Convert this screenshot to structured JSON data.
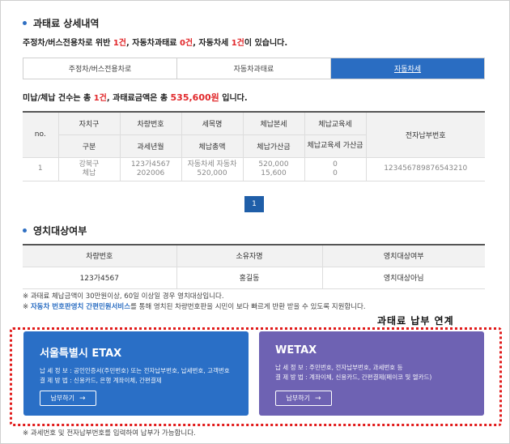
{
  "section1": {
    "title": "과태료 상세내역"
  },
  "summary": {
    "prefix": "주정차/버스전용차로 위반",
    "parking_count": "1건",
    "mid1": ", 자동차과태료",
    "car_count": "0건",
    "mid2": ", 자동차세",
    "tax_count": "1건",
    "suffix": "이 있습니다."
  },
  "tabs": [
    {
      "label": "주정차/버스전용차로"
    },
    {
      "label": "자동차과태료"
    },
    {
      "label": "자동차세"
    }
  ],
  "overdue": {
    "prefix": "미납/체납 건수는 총",
    "count": "1건",
    "mid": ", 과태료금액은 총",
    "amount": "535,600원",
    "suffix": "입니다."
  },
  "detail_table": {
    "headers_row1": [
      "no.",
      "자치구",
      "차량번호",
      "세목명",
      "체납본세",
      "체납교육세",
      "전자납부번호"
    ],
    "headers_row2": [
      "구분",
      "과세년월",
      "체납총액",
      "체납가산금",
      "체납교육세 가산금"
    ],
    "row": {
      "no": "1",
      "district": "강북구",
      "category": "체납",
      "plate": "123가4567",
      "tax_month": "202006",
      "tax_name": "자동차세 자동차",
      "total": "520,000",
      "principal": "520,000",
      "penalty": "15,600",
      "edu": "0",
      "edu_penalty": "0",
      "payment_no": "123456789876543210"
    }
  },
  "pagination": {
    "current": "1"
  },
  "section2": {
    "title": "영치대상여부"
  },
  "seizure_table": {
    "headers": [
      "차량번호",
      "소유자명",
      "영치대상여부"
    ],
    "row": {
      "plate": "123가4567",
      "owner": "홍길동",
      "status": "영치대상아님"
    }
  },
  "notes": {
    "line1": "※ 과태료 체납금액이 30만원이상, 60일 이상일 경우 영치대상입니다.",
    "line2_prefix": "※",
    "line2_link": "자동차 번호판영치 간편민원서비스",
    "line2_suffix": "를 통해 영치된 차량번호판을 시민이 보다 빠르게 반환 받을 수 있도록 지원합니다.",
    "bottom": "※ 과세번호 및 전자납부번호를 입력하여 납부가 가능합니다."
  },
  "link_label": "과태료 납부 연계",
  "cards": {
    "etax": {
      "title": "서울특별시 ETAX",
      "info": "납 세 정 보 : 공인인증서(주민번호) 또는 전자납부번호, 납세번호, 고객번호",
      "method": "결 제 방 법 : 신용카드, 은행 계좌이체, 간편결제",
      "button": "납부하기",
      "color": "#2a6fc6"
    },
    "wetax": {
      "title": "WETAX",
      "info": "납 세 정 보 : 주민번호, 전자납부번호, 과세번호 등",
      "method": "결 제 방 법 : 계좌이체, 신용카드, 간편결제(페이코 및 엘카드)",
      "button": "납부하기",
      "color": "#6e62b3"
    }
  }
}
